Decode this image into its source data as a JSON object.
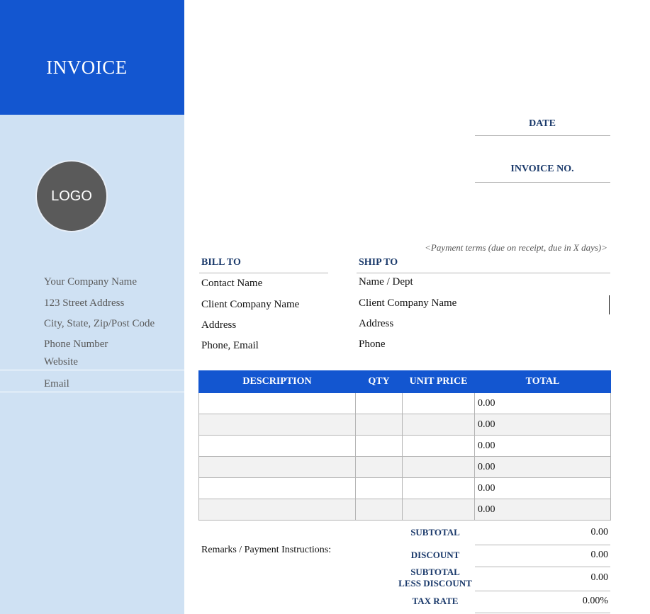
{
  "sidebar": {
    "title": "INVOICE",
    "logo_label": "LOGO",
    "company": {
      "name": "Your Company Name",
      "street": "123 Street Address",
      "city": "City, State, Zip/Post Code",
      "phone": "Phone Number",
      "website": "Website",
      "email": "Email"
    }
  },
  "header": {
    "date_label": "DATE",
    "invoice_no_label": "INVOICE NO.",
    "payment_terms": "<Payment terms (due on receipt, due in X days)>"
  },
  "bill_to": {
    "heading": "BILL TO",
    "contact": "Contact Name",
    "company": "Client Company Name",
    "address": "Address",
    "phone_email": "Phone, Email"
  },
  "ship_to": {
    "heading": "SHIP TO",
    "name": "Name / Dept",
    "company": "Client Company Name",
    "address": "Address",
    "phone": "Phone"
  },
  "items": {
    "columns": [
      "DESCRIPTION",
      "QTY",
      "UNIT PRICE",
      "TOTAL"
    ],
    "rows": [
      {
        "description": "",
        "qty": "",
        "unit_price": "",
        "total": "0.00"
      },
      {
        "description": "",
        "qty": "",
        "unit_price": "",
        "total": "0.00"
      },
      {
        "description": "",
        "qty": "",
        "unit_price": "",
        "total": "0.00"
      },
      {
        "description": "",
        "qty": "",
        "unit_price": "",
        "total": "0.00"
      },
      {
        "description": "",
        "qty": "",
        "unit_price": "",
        "total": "0.00"
      },
      {
        "description": "",
        "qty": "",
        "unit_price": "",
        "total": "0.00"
      }
    ]
  },
  "remarks_label": "Remarks / Payment Instructions:",
  "totals": {
    "subtotal_label": "SUBTOTAL",
    "subtotal_value": "0.00",
    "discount_label": "DISCOUNT",
    "discount_value": "0.00",
    "subtotal_less_line1": "SUBTOTAL",
    "subtotal_less_line2": "LESS DISCOUNT",
    "subtotal_less_value": "0.00",
    "tax_rate_label": "TAX RATE",
    "tax_rate_value": "0.00%"
  },
  "colors": {
    "accent": "#1356d0",
    "sidebar_bg": "#cfe1f3",
    "label_color": "#1b3a6b"
  }
}
